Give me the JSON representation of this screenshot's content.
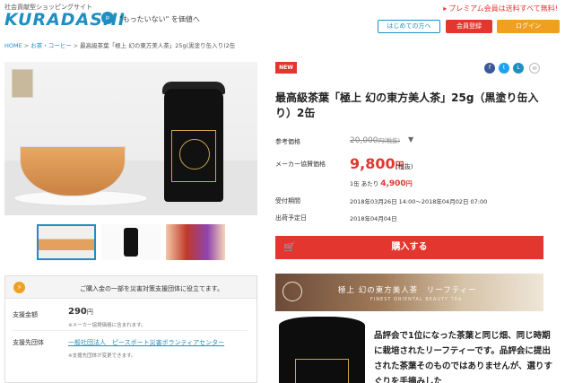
{
  "header": {
    "tagline": "社会貢献型ショッピングサイト",
    "logo": "KURADASHI",
    "logo_badge": "jp",
    "slogan": "\"もったいない\" を価値へ",
    "premium_link": "プレミアム会員は送料すべて無料!",
    "guide_button": "はじめての方へ",
    "register_button": "会員登録",
    "login_button": "ログイン"
  },
  "breadcrumb": [
    "HOME",
    "お茶・コーヒー",
    "最高級茶葉「極上 幻の東方美人茶」25g(黒塗り缶入り)2缶"
  ],
  "product": {
    "badge": "NEW",
    "title": "最高級茶葉「極上 幻の東方美人茶」25g（黒塗り缶入り）2缶",
    "ref_price_label": "参考価格",
    "ref_price": "20,000",
    "ref_price_tax": "円(税抜)",
    "sale_price_label": "メーカー協賛価格",
    "sale_price": "9,800",
    "sale_price_yen": "円",
    "sale_price_tax": "(税抜)",
    "unit_price_prefix": "1缶 あたり",
    "unit_price": "4,900",
    "unit_price_yen": "円",
    "period_label": "受付期間",
    "period_value": "2018年03月26日 14:00〜2018年04月02日 07:00",
    "ship_label": "出荷予定日",
    "ship_value": "2018年04月04日",
    "buy_button": "購入する"
  },
  "share": {
    "facebook": "f",
    "twitter": "t",
    "line": "L",
    "mail": "✉"
  },
  "donation": {
    "message": "ご購入金の一部を災害対策支援団体に役立てます。",
    "amount_label": "支援金額",
    "amount": "290",
    "amount_yen": "円",
    "amount_note": "※メーカー協賛価格に含まれます。",
    "org_label": "支援先団体",
    "org_name": "一般社団法人　ピースボート災害ボランティアセンター",
    "org_note": "※支援先団体が変更できます。"
  },
  "banner": {
    "title": "極上 幻の東方美人茶　リーフティー",
    "subtitle": "FINEST ORIENTAL BEAUTY TEA"
  },
  "description": "品評会で1位になった茶葉と同じ畑、同じ時期に栽培されたリーフティーです。品評会に提出された茶葉そのものではありませんが、選りすぐりを手摘みした",
  "icons": [
    "lightning-icon",
    "cart-icon",
    "facebook-icon",
    "twitter-icon",
    "line-icon",
    "mail-icon"
  ]
}
